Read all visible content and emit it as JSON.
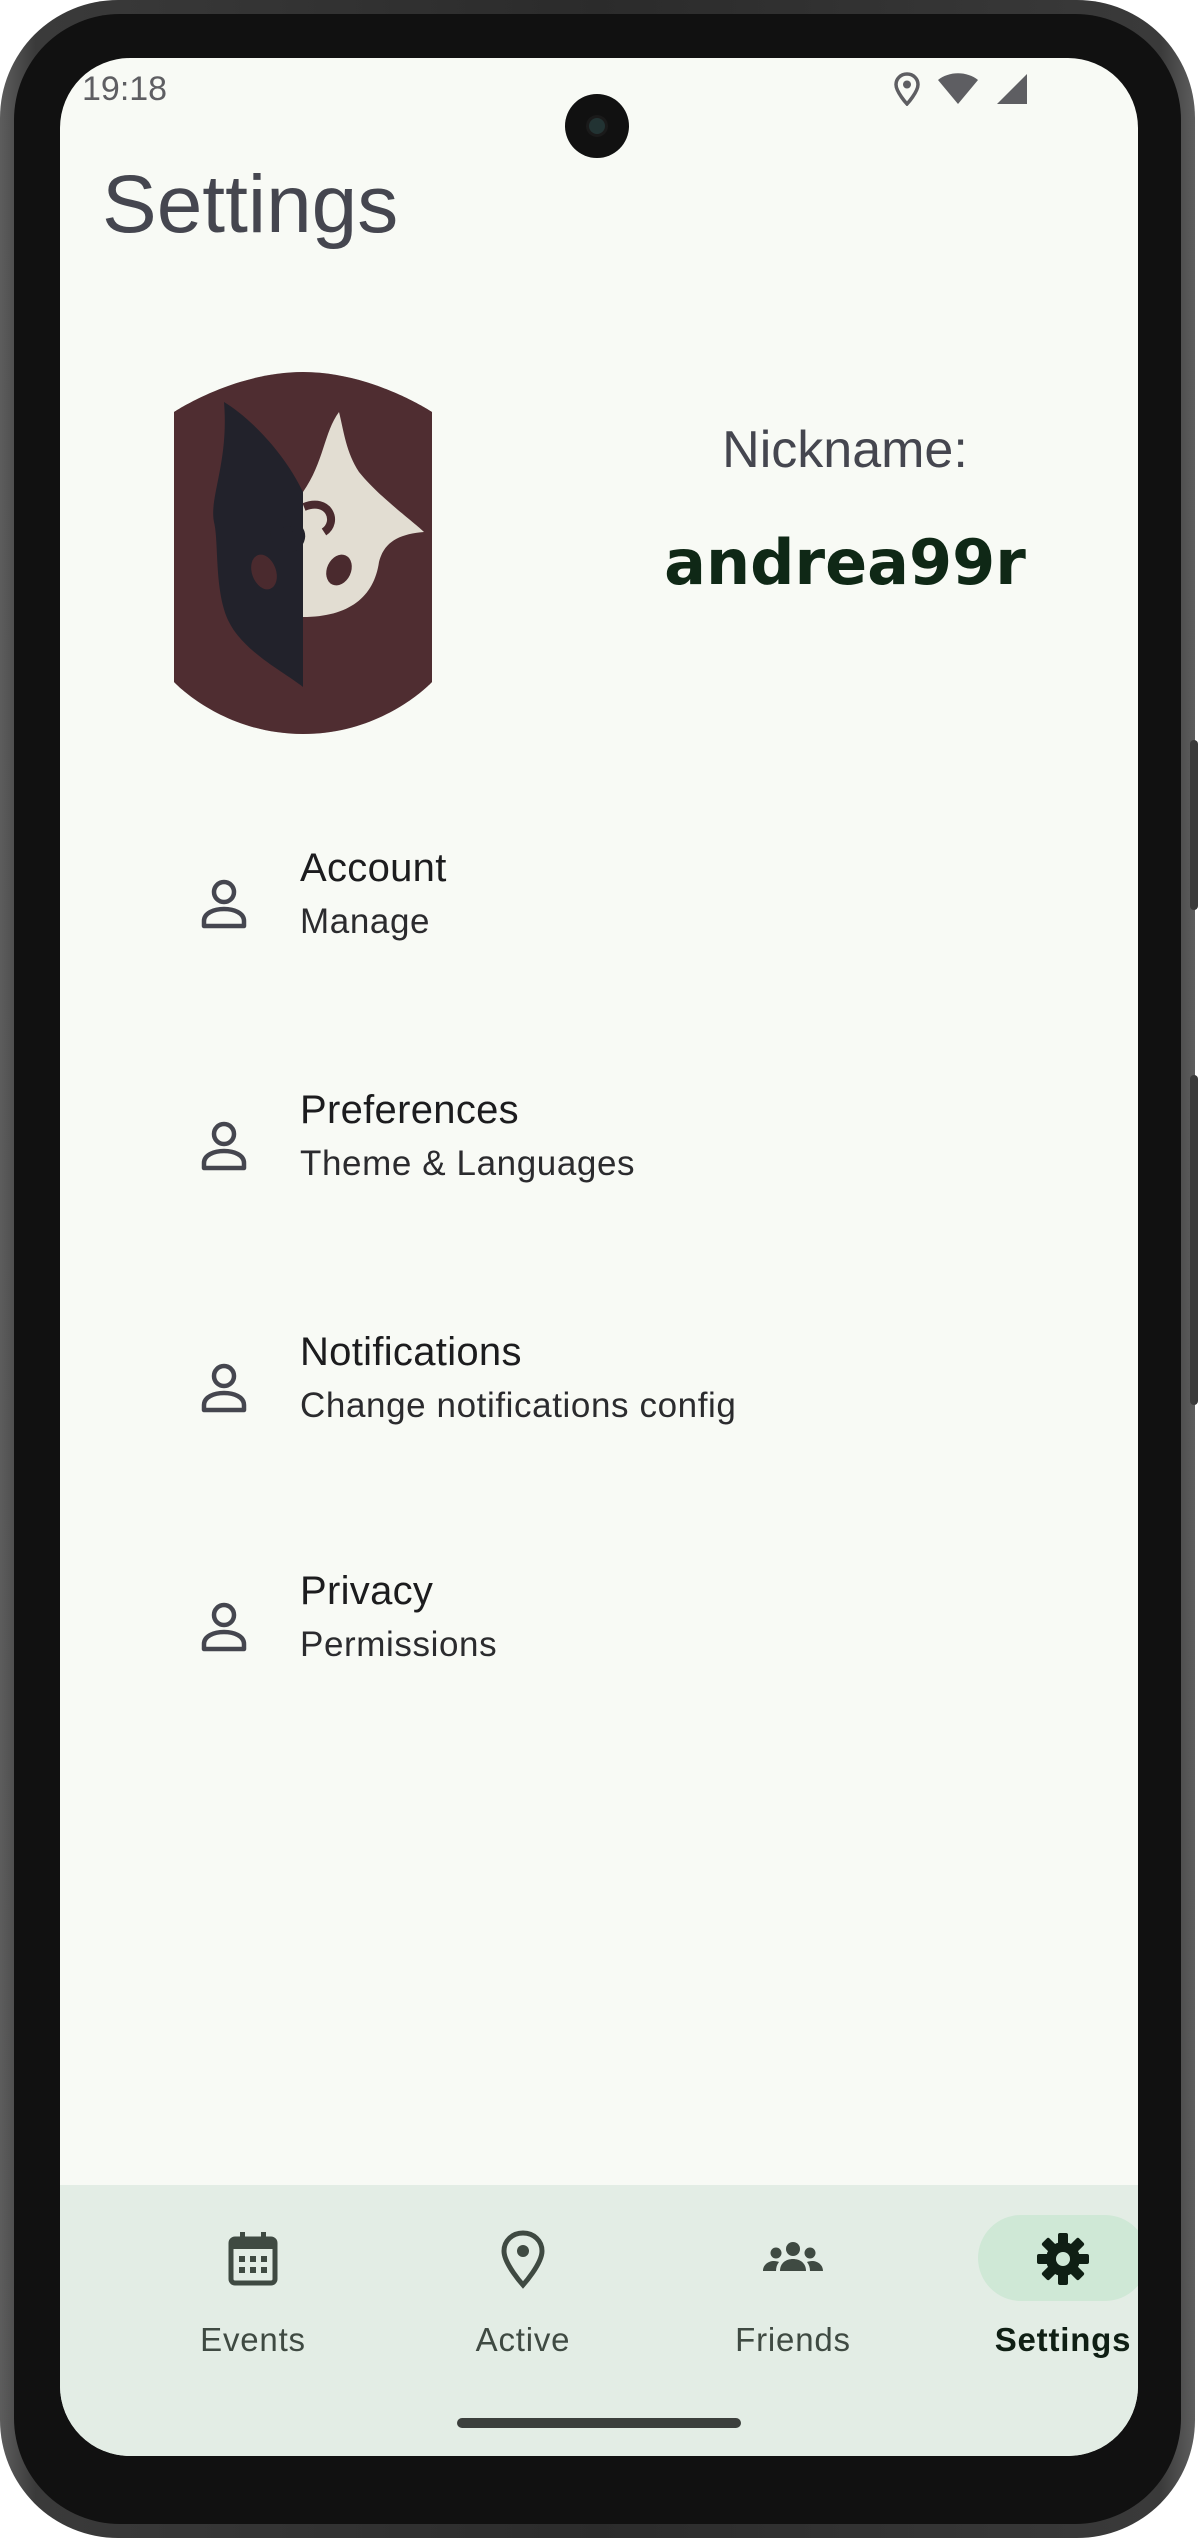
{
  "status_bar": {
    "time": "19:18",
    "icons": [
      "location-icon",
      "wifi-icon",
      "signal-icon"
    ]
  },
  "header": {
    "title": "Settings"
  },
  "profile": {
    "nickname_label": "Nickname:",
    "nickname": "andrea99r"
  },
  "menu": {
    "items": [
      {
        "title": "Account",
        "subtitle": "Manage",
        "icon": "person-icon"
      },
      {
        "title": "Preferences",
        "subtitle": "Theme & Languages",
        "icon": "person-icon"
      },
      {
        "title": "Notifications",
        "subtitle": "Change notifications config",
        "icon": "person-icon"
      },
      {
        "title": "Privacy",
        "subtitle": "Permissions",
        "icon": "person-icon"
      }
    ]
  },
  "bottom_nav": {
    "items": [
      {
        "label": "Events",
        "icon": "calendar-icon",
        "active": false
      },
      {
        "label": "Active",
        "icon": "location-pin-icon",
        "active": false
      },
      {
        "label": "Friends",
        "icon": "group-icon",
        "active": false
      },
      {
        "label": "Settings",
        "icon": "gear-icon",
        "active": true
      }
    ]
  },
  "colors": {
    "background": "#f8faf5",
    "nav_background": "#e3ede5",
    "active_pill": "#cfe8d6",
    "nickname": "#0f2816",
    "avatar_background": "#4a2a2e"
  }
}
